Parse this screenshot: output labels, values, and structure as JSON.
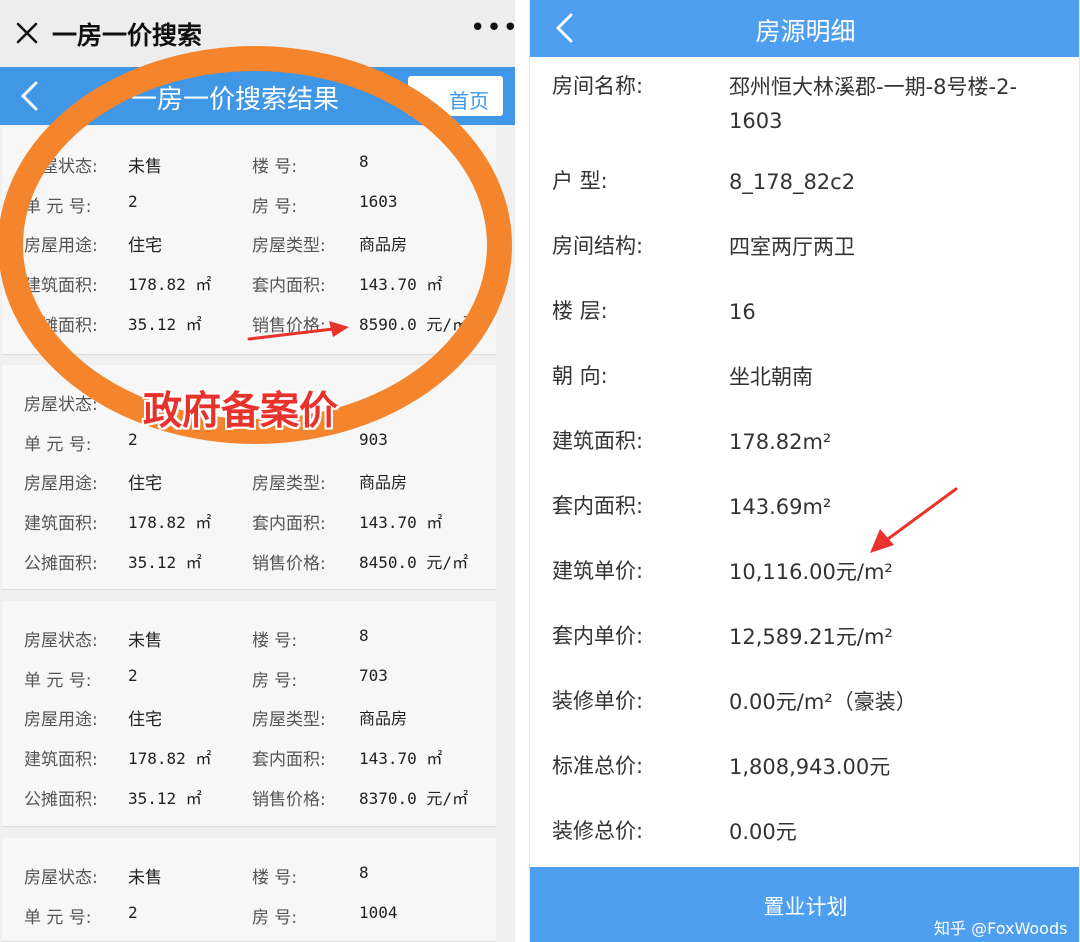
{
  "left": {
    "wechat_bar": {
      "title": "一房一价搜索"
    },
    "app_bar": {
      "title": "一房一价搜索结果",
      "right_button": "首页"
    },
    "cards": [
      {
        "rows": [
          {
            "l1": "房屋状态:",
            "v1": "未售",
            "l2": "楼    号:",
            "v2": "8"
          },
          {
            "l1": "单 元 号:",
            "v1": "2",
            "l2": "房    号:",
            "v2": "1603"
          },
          {
            "l1": "房屋用途:",
            "v1": "住宅",
            "l2": "房屋类型:",
            "v2": "商品房"
          },
          {
            "l1": "建筑面积:",
            "v1": "178.82 ㎡",
            "l2": "套内面积:",
            "v2": "143.70 ㎡"
          },
          {
            "l1": "公摊面积:",
            "v1": "35.12 ㎡",
            "l2": "销售价格:",
            "v2": "8590.0 元/㎡"
          }
        ]
      },
      {
        "rows": [
          {
            "l1": "房屋状态:",
            "v1": "",
            "l2": "",
            "v2": ""
          },
          {
            "l1": "单 元 号:",
            "v1": "2",
            "l2": "",
            "v2": "903"
          },
          {
            "l1": "房屋用途:",
            "v1": "住宅",
            "l2": "房屋类型:",
            "v2": "商品房"
          },
          {
            "l1": "建筑面积:",
            "v1": "178.82 ㎡",
            "l2": "套内面积:",
            "v2": "143.70 ㎡"
          },
          {
            "l1": "公摊面积:",
            "v1": "35.12 ㎡",
            "l2": "销售价格:",
            "v2": "8450.0 元/㎡"
          }
        ]
      },
      {
        "rows": [
          {
            "l1": "房屋状态:",
            "v1": "未售",
            "l2": "楼    号:",
            "v2": "8"
          },
          {
            "l1": "单 元 号:",
            "v1": "2",
            "l2": "房    号:",
            "v2": "703"
          },
          {
            "l1": "房屋用途:",
            "v1": "住宅",
            "l2": "房屋类型:",
            "v2": "商品房"
          },
          {
            "l1": "建筑面积:",
            "v1": "178.82 ㎡",
            "l2": "套内面积:",
            "v2": "143.70 ㎡"
          },
          {
            "l1": "公摊面积:",
            "v1": "35.12 ㎡",
            "l2": "销售价格:",
            "v2": "8370.0 元/㎡"
          }
        ]
      },
      {
        "rows": [
          {
            "l1": "房屋状态:",
            "v1": "未售",
            "l2": "楼    号:",
            "v2": "8"
          },
          {
            "l1": "单 元 号:",
            "v1": "2",
            "l2": "房    号:",
            "v2": "1004"
          }
        ]
      }
    ],
    "annotation": "政府备案价"
  },
  "right": {
    "header": {
      "title": "房源明细"
    },
    "details": [
      {
        "label": "房间名称:",
        "value": "邳州恒大林溪郡-一期-8号楼-2-1603"
      },
      {
        "label": "户  型:",
        "value": "8_178_82c2"
      },
      {
        "label": "房间结构:",
        "value": "四室两厅两卫"
      },
      {
        "label": "楼  层:",
        "value": "16"
      },
      {
        "label": "朝  向:",
        "value": "坐北朝南"
      },
      {
        "label": "建筑面积:",
        "value": "178.82m²"
      },
      {
        "label": "套内面积:",
        "value": "143.69m²"
      },
      {
        "label": "建筑单价:",
        "value": "10,116.00元/m²"
      },
      {
        "label": "套内单价:",
        "value": "12,589.21元/m²"
      },
      {
        "label": "装修单价:",
        "value": "0.00元/m²（豪装）"
      },
      {
        "label": "标准总价:",
        "value": "1,808,943.00元"
      },
      {
        "label": "装修总价:",
        "value": "0.00元"
      }
    ],
    "footer": {
      "label": "置业计划"
    },
    "credit": "知乎 @FoxWoods"
  },
  "colors": {
    "app_bar": "#3f97e6",
    "right_bar": "#4f9ff0",
    "ring": "#f4852d",
    "annotation": "#e8322c",
    "arrow": "#e8322c"
  },
  "icons": {
    "close": "close-icon",
    "more": "more-icon",
    "back": "chevron-left-icon"
  }
}
